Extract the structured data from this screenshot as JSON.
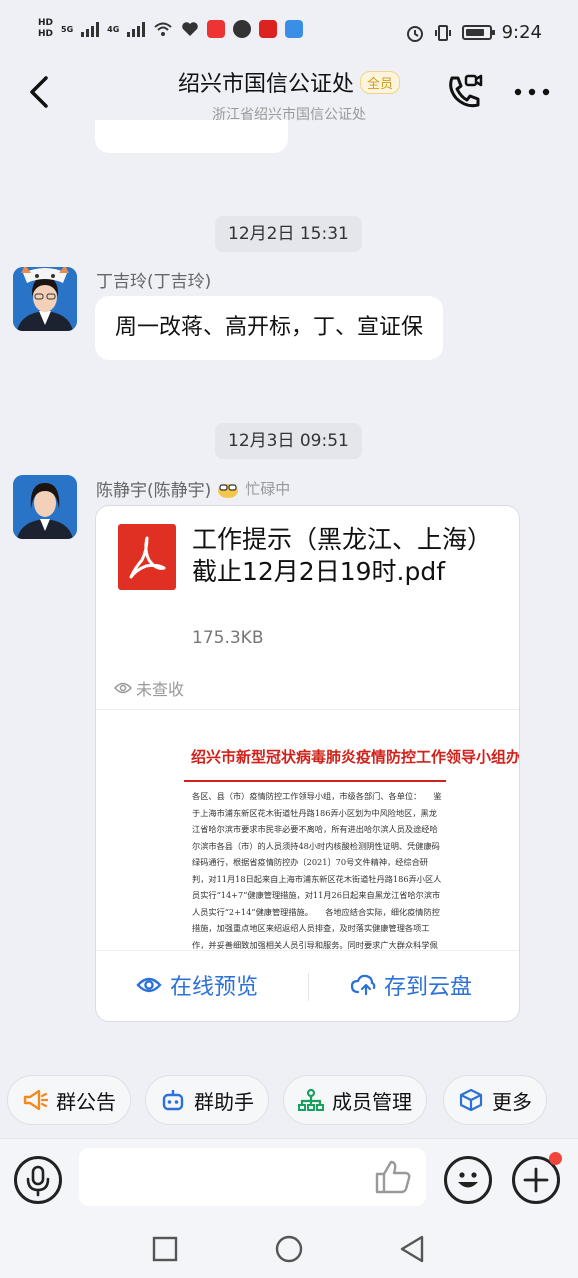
{
  "status_bar": {
    "network_1": "HD",
    "network_2": "HD",
    "gen_1": "5G",
    "gen_2": "4G",
    "time": "9:24"
  },
  "header": {
    "title": "绍兴市国信公证处",
    "badge": "全员",
    "subtitle": "浙江省绍兴市国信公证处",
    "back_icon": "chevron-left-icon",
    "call_icon": "phone-video-icon",
    "more_icon": "more-dots-icon"
  },
  "messages": [
    {
      "type": "time",
      "text": "12月2日 15:31"
    },
    {
      "type": "text",
      "sender": "丁吉玲(丁吉玲)",
      "text": "周一改蒋、高开标，丁、宣证保"
    },
    {
      "type": "time",
      "text": "12月3日 09:51"
    },
    {
      "type": "file",
      "sender": "陈静宇(陈静宇)",
      "sender_status": "忙碌中",
      "file_name": "工作提示（黑龙江、上海）截止12月2日19时.pdf",
      "file_size": "175.3KB",
      "read_status": "未查收",
      "preview": {
        "title": "绍兴市新型冠状病毒肺炎疫情防控工作领导小组办公室",
        "body": "各区、县（市）疫情防控工作领导小组，市级各部门、各单位：　　鉴于上海市浦东新区花木街道牡丹路186弄小区划为中风险地区，黑龙江省哈尔滨市要求市民非必要不离哈，所有进出哈尔滨人员及途经哈尔滨市各县（市）的人员须持48小时内核酸检测阴性证明、凭健康码绿码通行，根据省疫情防控办〔2021〕70号文件精神，经综合研判，对11月18日起来自上海市浦东新区花木街道牡丹路186弄小区人员实行“14+7”健康管理措施，对11月26日起来自黑龙江省哈尔滨市人员实行“2+14”健康管理措施。　　各地应结合实际，细化疫情防控措施，加强重点地区来绍返绍人员排查，及时落实健康管理各项工作，并妥善细致加强相关人员引导和服务。同时要求广大群众科学佩戴口罩，勤洗手，常"
      },
      "action_preview": "在线预览",
      "action_save": "存到云盘"
    }
  ],
  "quick_actions": [
    {
      "label": "群公告",
      "icon": "megaphone-icon"
    },
    {
      "label": "群助手",
      "icon": "robot-icon"
    },
    {
      "label": "成员管理",
      "icon": "org-chart-icon"
    },
    {
      "label": "更多",
      "icon": "cube-icon"
    }
  ],
  "input": {
    "placeholder": ""
  },
  "colors": {
    "accent": "#2b71d6",
    "pdf": "#e02f23",
    "badge": "#d19b1c"
  }
}
